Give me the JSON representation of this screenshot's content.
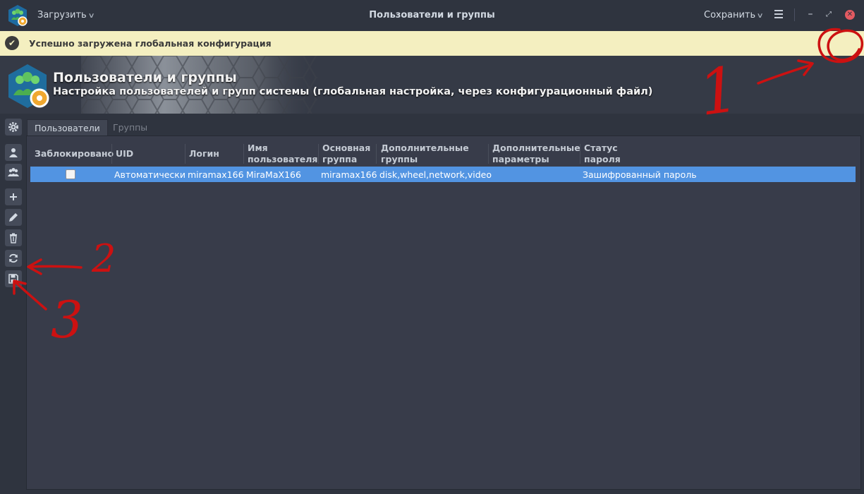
{
  "window": {
    "title": "Пользователи и группы",
    "load_menu": "Загрузить",
    "save_menu": "Сохранить"
  },
  "notification": {
    "text": "Успешно загружена глобальная конфигурация"
  },
  "header": {
    "title": "Пользователи и группы",
    "subtitle": "Настройка пользователей и групп системы (глобальная настройка, через конфигурационный файл)"
  },
  "sidebar": {
    "items": [
      {
        "icon": "gear-icon"
      },
      {
        "icon": "user-icon"
      },
      {
        "icon": "group-icon"
      },
      {
        "icon": "plus-icon"
      },
      {
        "icon": "pencil-icon"
      },
      {
        "icon": "trash-icon"
      },
      {
        "icon": "refresh-icon"
      },
      {
        "icon": "save-icon"
      }
    ]
  },
  "tabs": [
    {
      "label": "Пользователи",
      "active": true
    },
    {
      "label": "Группы",
      "active": false
    }
  ],
  "table": {
    "headers": {
      "locked": "Заблокировано",
      "uid": "UID",
      "login": "Логин",
      "username_1": "Имя",
      "username_2": "пользователя",
      "primary_1": "Основная",
      "primary_2": "группа",
      "addgroups_1": "Дополнительные",
      "addgroups_2": "группы",
      "addparams_1": "Дополнительные",
      "addparams_2": "параметры",
      "status_1": "Статус",
      "status_2": "пароля"
    },
    "rows": [
      {
        "locked": false,
        "uid": "Автоматически",
        "login": "miramax166",
        "username": "MiraMaX166",
        "primary_group": "miramax166",
        "additional_groups": "disk,wheel,network,video",
        "additional_params": "",
        "password_status": "Зашифрованный пароль"
      }
    ]
  },
  "annotations": {
    "labels": [
      "1",
      "2",
      "3"
    ],
    "color": "#cc1111"
  },
  "colors": {
    "background": "#2f343f",
    "notification": "#f4efc0",
    "selection": "#5294e2",
    "close": "#e35a61"
  }
}
